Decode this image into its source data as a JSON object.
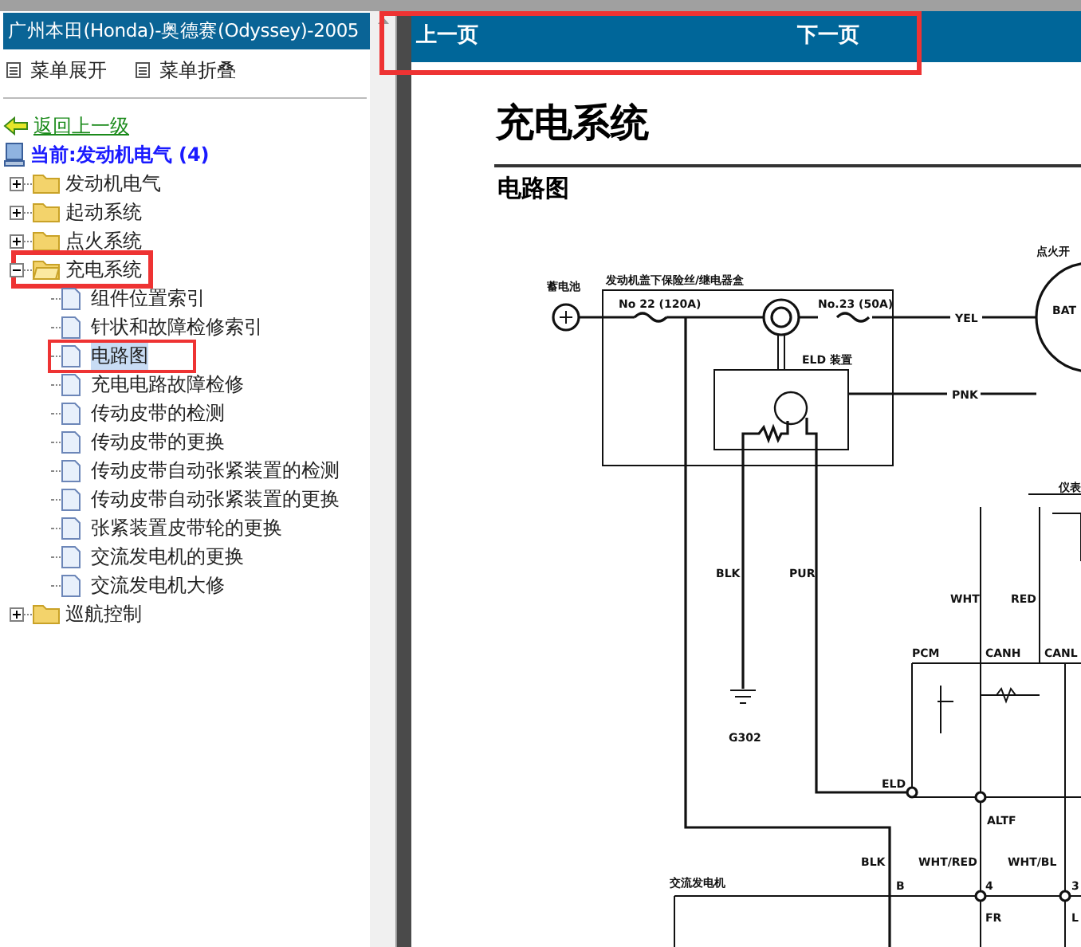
{
  "sidebar": {
    "title": "广州本田(Honda)-奥德赛(Odyssey)-2005",
    "toolbar": [
      {
        "label": "菜单展开"
      },
      {
        "label": "菜单折叠"
      }
    ],
    "back_link": "返回上一级",
    "current": "当前:发动机电气 (4)",
    "tree": [
      {
        "label": "发动机电气",
        "expanded": false,
        "annotated": false
      },
      {
        "label": "起动系统",
        "expanded": false,
        "annotated": false
      },
      {
        "label": "点火系统",
        "expanded": false,
        "annotated": false
      },
      {
        "label": "充电系统",
        "expanded": true,
        "annotated": true,
        "children": [
          {
            "label": "组件位置索引",
            "selected": false,
            "annotated": false
          },
          {
            "label": "针状和故障检修索引",
            "selected": false,
            "annotated": false
          },
          {
            "label": "电路图",
            "selected": true,
            "annotated": true
          },
          {
            "label": "充电电路故障检修",
            "selected": false,
            "annotated": false
          },
          {
            "label": "传动皮带的检测",
            "selected": false,
            "annotated": false
          },
          {
            "label": "传动皮带的更换",
            "selected": false,
            "annotated": false
          },
          {
            "label": "传动皮带自动张紧装置的检测",
            "selected": false,
            "annotated": false
          },
          {
            "label": "传动皮带自动张紧装置的更换",
            "selected": false,
            "annotated": false
          },
          {
            "label": "张紧装置皮带轮的更换",
            "selected": false,
            "annotated": false
          },
          {
            "label": "交流发电机的更换",
            "selected": false,
            "annotated": false
          },
          {
            "label": "交流发电机大修",
            "selected": false,
            "annotated": false
          }
        ]
      },
      {
        "label": "巡航控制",
        "expanded": false,
        "annotated": false
      }
    ]
  },
  "nav": {
    "prev": "上一页",
    "next": "下一页",
    "annotated": true
  },
  "document": {
    "title": "充电系统",
    "subtitle": "电路图",
    "diagram_labels": [
      "发动机盖下保险丝/继电器盒",
      "蓄电池",
      "No 22 (120A)",
      "No.23 (50A)",
      "YEL",
      "点火开",
      "BAT",
      "ELD 装置",
      "PNK",
      "仪表",
      "BLK",
      "PUR",
      "WHT",
      "RED",
      "PCM",
      "CANH",
      "CANL",
      "G302",
      "ELD",
      "ALTF",
      "BLK",
      "WHT/RED",
      "WHT/BL",
      "交流发电机",
      "B",
      "4",
      "3",
      "FR",
      "L"
    ]
  }
}
